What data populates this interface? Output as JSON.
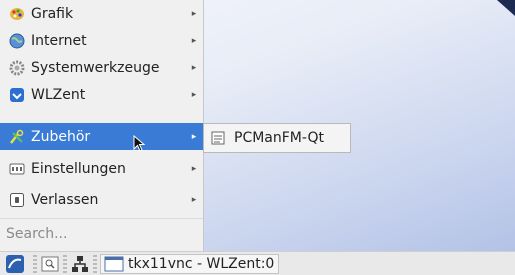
{
  "menu": {
    "items": [
      {
        "label": "Grafik",
        "icon": "graphics-icon"
      },
      {
        "label": "Internet",
        "icon": "globe-icon"
      },
      {
        "label": "Systemwerkzeuge",
        "icon": "gear-icon"
      },
      {
        "label": "WLZent",
        "icon": "wlzent-icon"
      },
      {
        "label": "Zubehör",
        "icon": "accessories-icon",
        "active": true
      },
      {
        "label": "Einstellungen",
        "icon": "settings-icon"
      },
      {
        "label": "Verlassen",
        "icon": "exit-icon"
      }
    ],
    "search_placeholder": "Search..."
  },
  "submenu": {
    "items": [
      {
        "label": "PCManFM-Qt",
        "icon": "file-manager-icon"
      }
    ]
  },
  "taskbar": {
    "task_label": "tkx11vnc - WLZent:0"
  },
  "colors": {
    "highlight": "#3a7bd5",
    "menu_bg": "#f0f0f0"
  }
}
